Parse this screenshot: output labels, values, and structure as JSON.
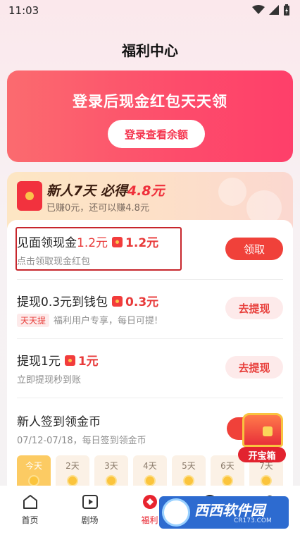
{
  "status_bar": {
    "time": "11:03"
  },
  "header": {
    "title": "福利中心"
  },
  "banner": {
    "title": "登录后现金红包天天领",
    "button": "登录查看余额"
  },
  "newuser": {
    "title_prefix": "新人7天 必得",
    "title_amount": "4.8元",
    "subtitle": "已赚0元，还可以赚4.8元"
  },
  "tasks": [
    {
      "title": "见面领现金",
      "title_amount": "1.2元",
      "bonus": "1.2元",
      "subtitle": "点击领取现金红包",
      "button": "领取"
    },
    {
      "title": "提现0.3元到钱包",
      "bonus": "0.3元",
      "tag": "天天提",
      "subtitle": "福利用户专享，每日可提!",
      "button": "去提现"
    },
    {
      "title": "提现1元",
      "bonus": "1元",
      "subtitle": "立即提现秒到账",
      "button": "去提现"
    }
  ],
  "checkin": {
    "title": "新人签到领金币",
    "subtitle": "07/12-07/18，每日签到领金币",
    "days": [
      "今天",
      "2天",
      "3天",
      "4天",
      "5天",
      "6天",
      "7天"
    ]
  },
  "treasure": {
    "label": "开宝箱"
  },
  "tabbar": [
    {
      "label": "首页",
      "icon": "home-icon"
    },
    {
      "label": "剧场",
      "icon": "play-icon"
    },
    {
      "label": "福利",
      "icon": "welfare-icon"
    },
    {
      "label": "",
      "icon": "discover-icon"
    },
    {
      "label": "",
      "icon": "profile-icon"
    }
  ],
  "watermark": {
    "brand": "西西软件园",
    "url": "CR173.COM"
  },
  "colors": {
    "accent": "#f0413a",
    "banner": "#fd4c6b",
    "tab_active": "#e8242f"
  }
}
